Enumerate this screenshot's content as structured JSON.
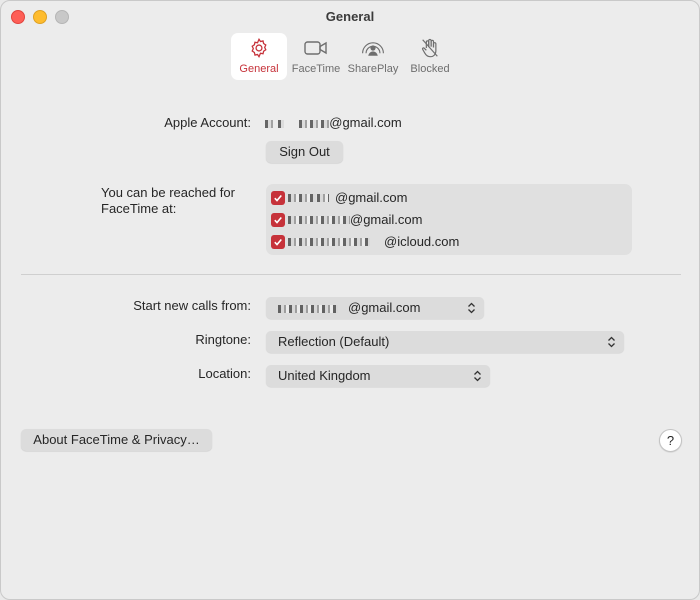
{
  "window": {
    "title": "General"
  },
  "toolbar": {
    "items": [
      {
        "label": "General",
        "icon": "gear-icon",
        "active": true
      },
      {
        "label": "FaceTime",
        "icon": "video-camera-icon",
        "active": false
      },
      {
        "label": "SharePlay",
        "icon": "shareplay-icon",
        "active": false
      },
      {
        "label": "Blocked",
        "icon": "raised-hand-icon",
        "active": false
      }
    ]
  },
  "account": {
    "label": "Apple Account:",
    "email_suffix": "@gmail.com",
    "sign_out": "Sign Out"
  },
  "reach": {
    "label_line1": "You can be reached for",
    "label_line2": "FaceTime at:",
    "addresses": [
      {
        "suffix": "@gmail.com",
        "checked": true
      },
      {
        "suffix": "@gmail.com",
        "checked": true
      },
      {
        "suffix": "@icloud.com",
        "checked": true
      }
    ]
  },
  "calls": {
    "label": "Start new calls from:",
    "value_suffix": "@gmail.com"
  },
  "ringtone": {
    "label": "Ringtone:",
    "value": "Reflection (Default)"
  },
  "location": {
    "label": "Location:",
    "value": "United Kingdom"
  },
  "footer": {
    "about_label": "About FaceTime & Privacy…",
    "help_label": "?"
  },
  "colors": {
    "accent": "#c6323a",
    "background": "#ececec"
  }
}
